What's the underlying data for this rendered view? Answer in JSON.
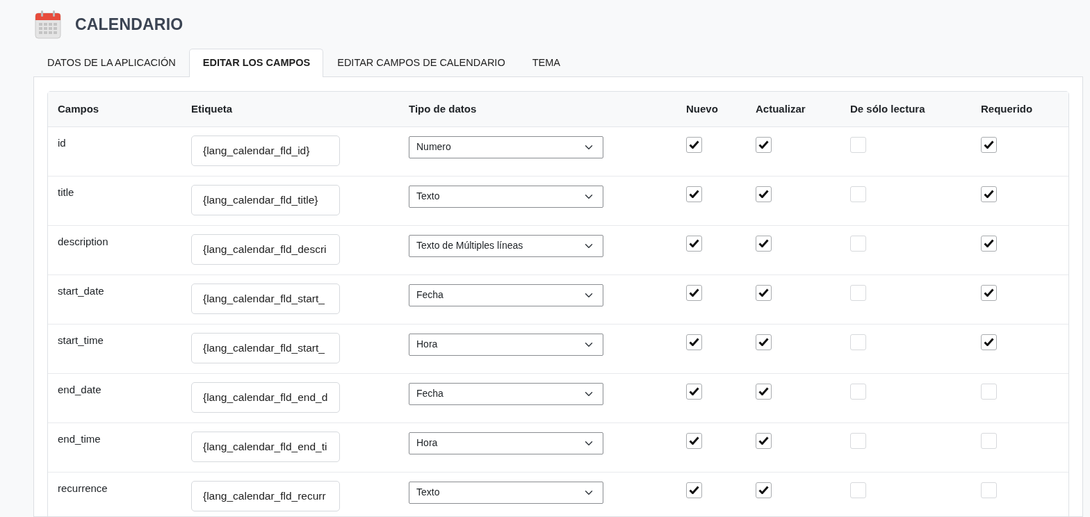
{
  "header": {
    "title": "CALENDARIO"
  },
  "tabs": [
    {
      "label": "DATOS DE LA APLICACIÓN",
      "selected": false
    },
    {
      "label": "EDITAR LOS CAMPOS",
      "selected": true
    },
    {
      "label": "EDITAR CAMPOS DE CALENDARIO",
      "selected": false
    },
    {
      "label": "TEMA",
      "selected": false
    }
  ],
  "table": {
    "columns": [
      "Campos",
      "Etiqueta",
      "Tipo de datos",
      "Nuevo",
      "Actualizar",
      "De sólo lectura",
      "Requerido"
    ],
    "rows": [
      {
        "field": "id",
        "label": "{lang_calendar_fld_id}",
        "type": "Numero",
        "new": true,
        "update": true,
        "readonly": false,
        "required": true
      },
      {
        "field": "title",
        "label": "{lang_calendar_fld_title}",
        "type": "Texto",
        "new": true,
        "update": true,
        "readonly": false,
        "required": true
      },
      {
        "field": "description",
        "label": "{lang_calendar_fld_descri",
        "type": "Texto de Múltiples líneas",
        "new": true,
        "update": true,
        "readonly": false,
        "required": true
      },
      {
        "field": "start_date",
        "label": "{lang_calendar_fld_start_",
        "type": "Fecha",
        "new": true,
        "update": true,
        "readonly": false,
        "required": true
      },
      {
        "field": "start_time",
        "label": "{lang_calendar_fld_start_",
        "type": "Hora",
        "new": true,
        "update": true,
        "readonly": false,
        "required": true
      },
      {
        "field": "end_date",
        "label": "{lang_calendar_fld_end_d",
        "type": "Fecha",
        "new": true,
        "update": true,
        "readonly": false,
        "required": false
      },
      {
        "field": "end_time",
        "label": "{lang_calendar_fld_end_ti",
        "type": "Hora",
        "new": true,
        "update": true,
        "readonly": false,
        "required": false
      },
      {
        "field": "recurrence",
        "label": "{lang_calendar_fld_recurr",
        "type": "Texto",
        "new": true,
        "update": true,
        "readonly": false,
        "required": false
      }
    ]
  }
}
